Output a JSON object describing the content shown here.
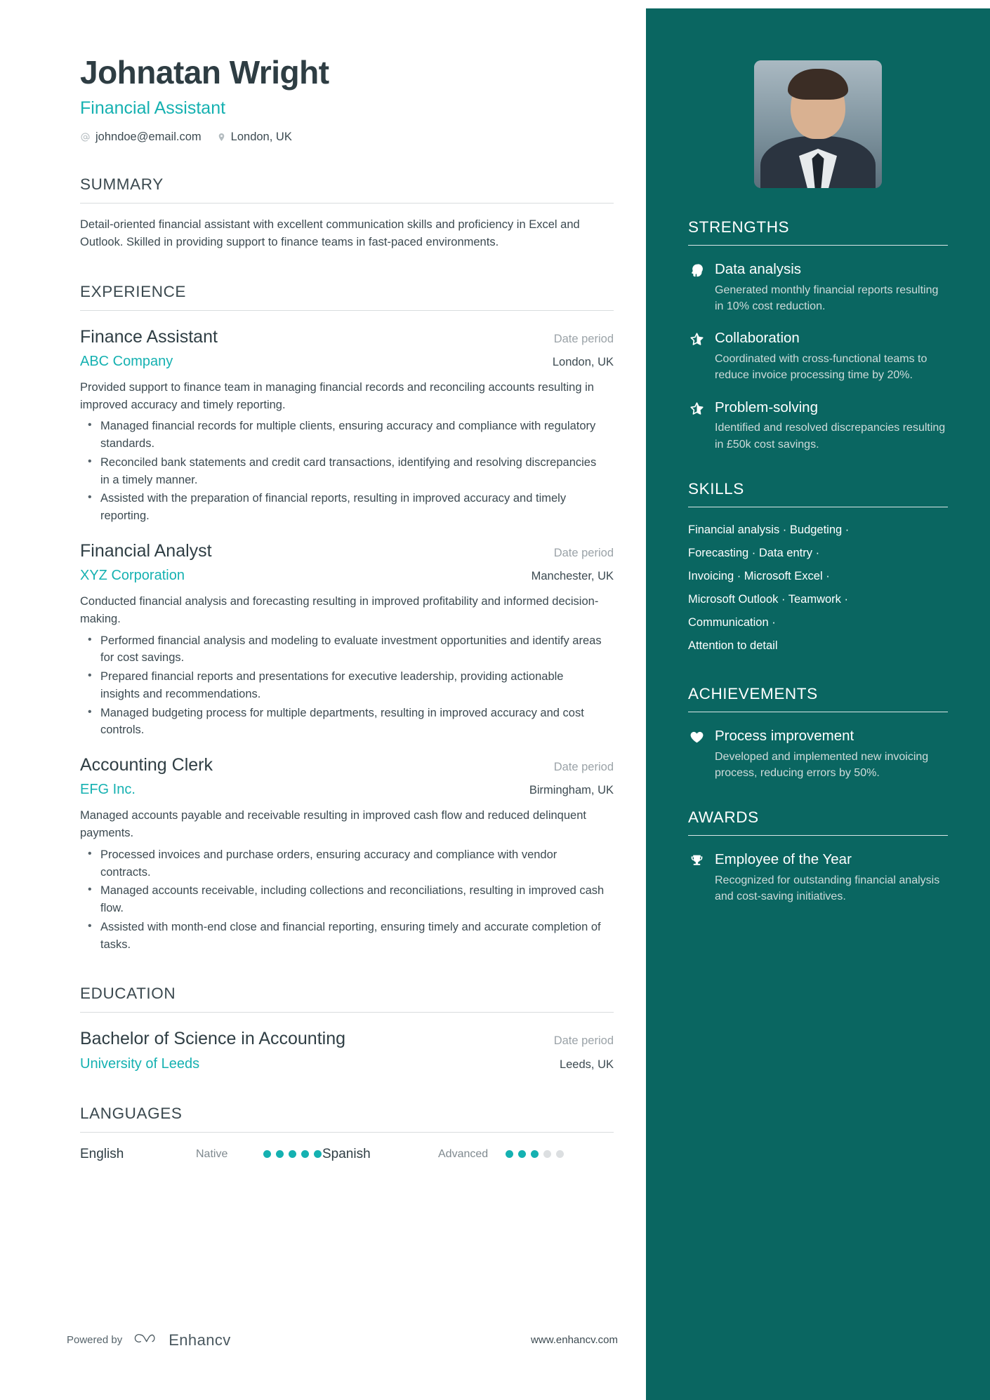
{
  "header": {
    "name": "Johnatan Wright",
    "job_title": "Financial Assistant",
    "email": "johndoe@email.com",
    "location": "London, UK",
    "email_icon": "at-icon",
    "location_icon": "map-pin-icon"
  },
  "summary": {
    "title": "SUMMARY",
    "text": "Detail-oriented financial assistant with excellent communication skills and proficiency in Excel and Outlook. Skilled in providing support to finance teams in fast-paced environments."
  },
  "experience": {
    "title": "EXPERIENCE",
    "entries": [
      {
        "role": "Finance Assistant",
        "date": "Date period",
        "organization": "ABC Company",
        "location": "London, UK",
        "description": "Provided support to finance team in managing financial records and reconciling accounts resulting in improved accuracy and timely reporting.",
        "bullets": [
          "Managed financial records for multiple clients, ensuring accuracy and compliance with regulatory standards.",
          "Reconciled bank statements and credit card transactions, identifying and resolving discrepancies in a timely manner.",
          "Assisted with the preparation of financial reports, resulting in improved accuracy and timely reporting."
        ]
      },
      {
        "role": "Financial Analyst",
        "date": "Date period",
        "organization": "XYZ Corporation",
        "location": "Manchester, UK",
        "description": "Conducted financial analysis and forecasting resulting in improved profitability and informed decision-making.",
        "bullets": [
          "Performed financial analysis and modeling to evaluate investment opportunities and identify areas for cost savings.",
          "Prepared financial reports and presentations for executive leadership, providing actionable insights and recommendations.",
          "Managed budgeting process for multiple departments, resulting in improved accuracy and cost controls."
        ]
      },
      {
        "role": "Accounting Clerk",
        "date": "Date period",
        "organization": "EFG Inc.",
        "location": "Birmingham, UK",
        "description": "Managed accounts payable and receivable resulting in improved cash flow and reduced delinquent payments.",
        "bullets": [
          "Processed invoices and purchase orders, ensuring accuracy and compliance with vendor contracts.",
          "Managed accounts receivable, including collections and reconciliations, resulting in improved cash flow.",
          "Assisted with month-end close and financial reporting, ensuring timely and accurate completion of tasks."
        ]
      }
    ]
  },
  "education": {
    "title": "EDUCATION",
    "entries": [
      {
        "degree": "Bachelor of Science in Accounting",
        "date": "Date period",
        "school": "University of Leeds",
        "location": "Leeds, UK"
      }
    ]
  },
  "languages": {
    "title": "LANGUAGES",
    "items": [
      {
        "name": "English",
        "level": "Native",
        "rating": 5,
        "max": 5
      },
      {
        "name": "Spanish",
        "level": "Advanced",
        "rating": 3,
        "max": 5
      }
    ]
  },
  "footer": {
    "powered_by": "Powered by",
    "brand": "Enhancv",
    "brand_icon": "enhancv-logo-icon",
    "url": "www.enhancv.com"
  },
  "sidebar": {
    "avatar_alt": "profile-photo",
    "strengths": {
      "title": "STRENGTHS",
      "items": [
        {
          "icon": "head-idea-icon",
          "title": "Data analysis",
          "desc": "Generated monthly financial reports resulting in 10% cost reduction."
        },
        {
          "icon": "star-half-icon",
          "title": "Collaboration",
          "desc": "Coordinated with cross-functional teams to reduce invoice processing time by 20%."
        },
        {
          "icon": "star-half-icon",
          "title": "Problem-solving",
          "desc": "Identified and resolved discrepancies resulting in £50k cost savings."
        }
      ]
    },
    "skills": {
      "title": "SKILLS",
      "lines": [
        "Financial analysis · Budgeting ·",
        "Forecasting · Data entry ·",
        "Invoicing · Microsoft Excel ·",
        "Microsoft Outlook · Teamwork ·",
        "Communication ·",
        "Attention to detail"
      ]
    },
    "achievements": {
      "title": "ACHIEVEMENTS",
      "items": [
        {
          "icon": "heart-icon",
          "title": "Process improvement",
          "desc": "Developed and implemented new invoicing process, reducing errors by 50%."
        }
      ]
    },
    "awards": {
      "title": "AWARDS",
      "items": [
        {
          "icon": "trophy-icon",
          "title": "Employee of the Year",
          "desc": "Recognized for outstanding financial analysis and cost-saving initiatives."
        }
      ]
    }
  },
  "colors": {
    "accent": "#15b1b1",
    "sidebar_bg": "#0a6661",
    "heading": "#3b494f",
    "body_text": "#3c4a51",
    "muted": "#9ba3a8"
  }
}
